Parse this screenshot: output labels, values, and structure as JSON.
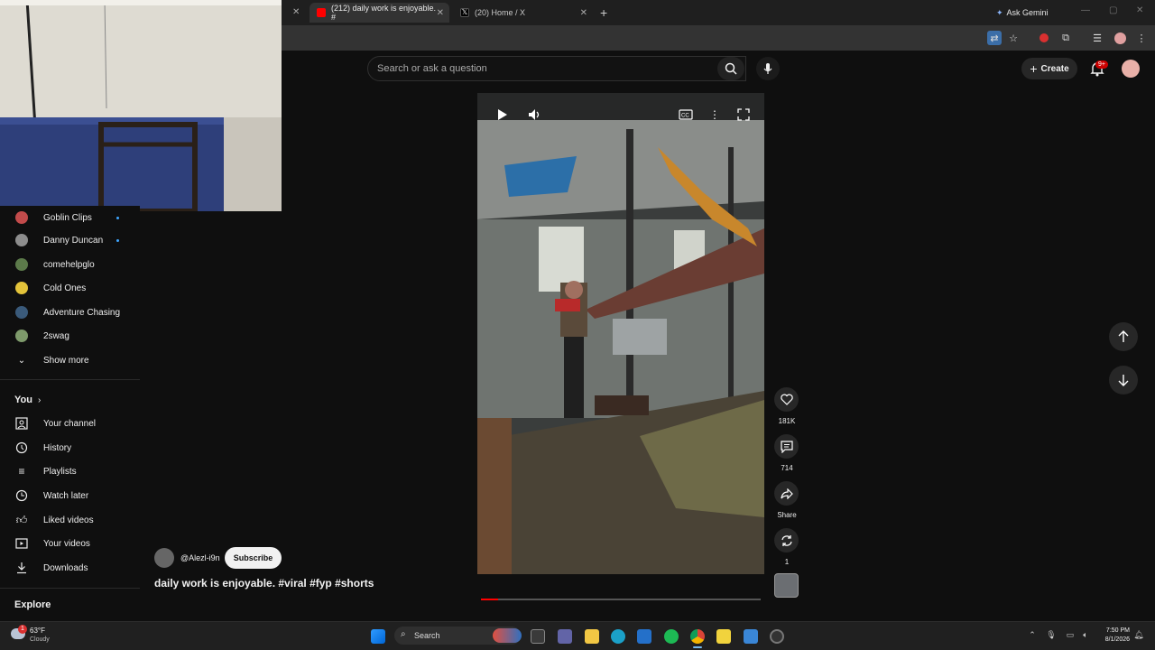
{
  "browser": {
    "tabs": [
      {
        "title": "(212) daily work is enjoyable. #",
        "active": true
      },
      {
        "title": "(20) Home / X",
        "active": false
      }
    ],
    "new_tab": "+",
    "ask_gemini": "Ask Gemini",
    "window_controls": [
      "minimize",
      "restore",
      "close"
    ]
  },
  "youtube": {
    "search_placeholder": "Search or ask a question",
    "create_label": "Create",
    "notifications_badge": "9+"
  },
  "sidebar": {
    "subscriptions": [
      {
        "label": "Goblin Clips",
        "avatar_color": "#c24b4b",
        "new": true
      },
      {
        "label": "Danny Duncan",
        "avatar_color": "#8d8d8d",
        "new": true
      },
      {
        "label": "comehelpglo",
        "avatar_color": "#5c7a4a",
        "new": false
      },
      {
        "label": "Cold Ones",
        "avatar_color": "#e3c33a",
        "new": false
      },
      {
        "label": "Adventure Chasing",
        "avatar_color": "#3a5a7a",
        "new": false
      },
      {
        "label": "2swag",
        "avatar_color": "#7e9a6b",
        "new": false
      }
    ],
    "show_more": "Show more",
    "you_heading": "You",
    "you_items": [
      {
        "label": "Your channel",
        "icon": "channel-icon"
      },
      {
        "label": "History",
        "icon": "history-icon"
      },
      {
        "label": "Playlists",
        "icon": "playlists-icon"
      },
      {
        "label": "Watch later",
        "icon": "watch-later-icon"
      },
      {
        "label": "Liked videos",
        "icon": "like-icon"
      },
      {
        "label": "Your videos",
        "icon": "your-videos-icon"
      },
      {
        "label": "Downloads",
        "icon": "download-icon"
      }
    ],
    "explore_heading": "Explore"
  },
  "short": {
    "channel_handle": "@Alezl-i9n",
    "subscribe_label": "Subscribe",
    "title": "daily work is enjoyable. #viral #fyp #shorts",
    "progress": 0.06,
    "likes": "181K",
    "comments": "714",
    "share_label": "Share",
    "remix_count": "1"
  },
  "taskbar": {
    "weather_temp": "63°F",
    "weather_condition": "Cloudy",
    "weather_alert": "1",
    "search_label": "Search",
    "time": "7:50 PM",
    "date": "8/1/2026"
  },
  "colors": {
    "yt_red": "#ff0000",
    "background": "#0f0f0f",
    "taskbar": "#202020"
  }
}
